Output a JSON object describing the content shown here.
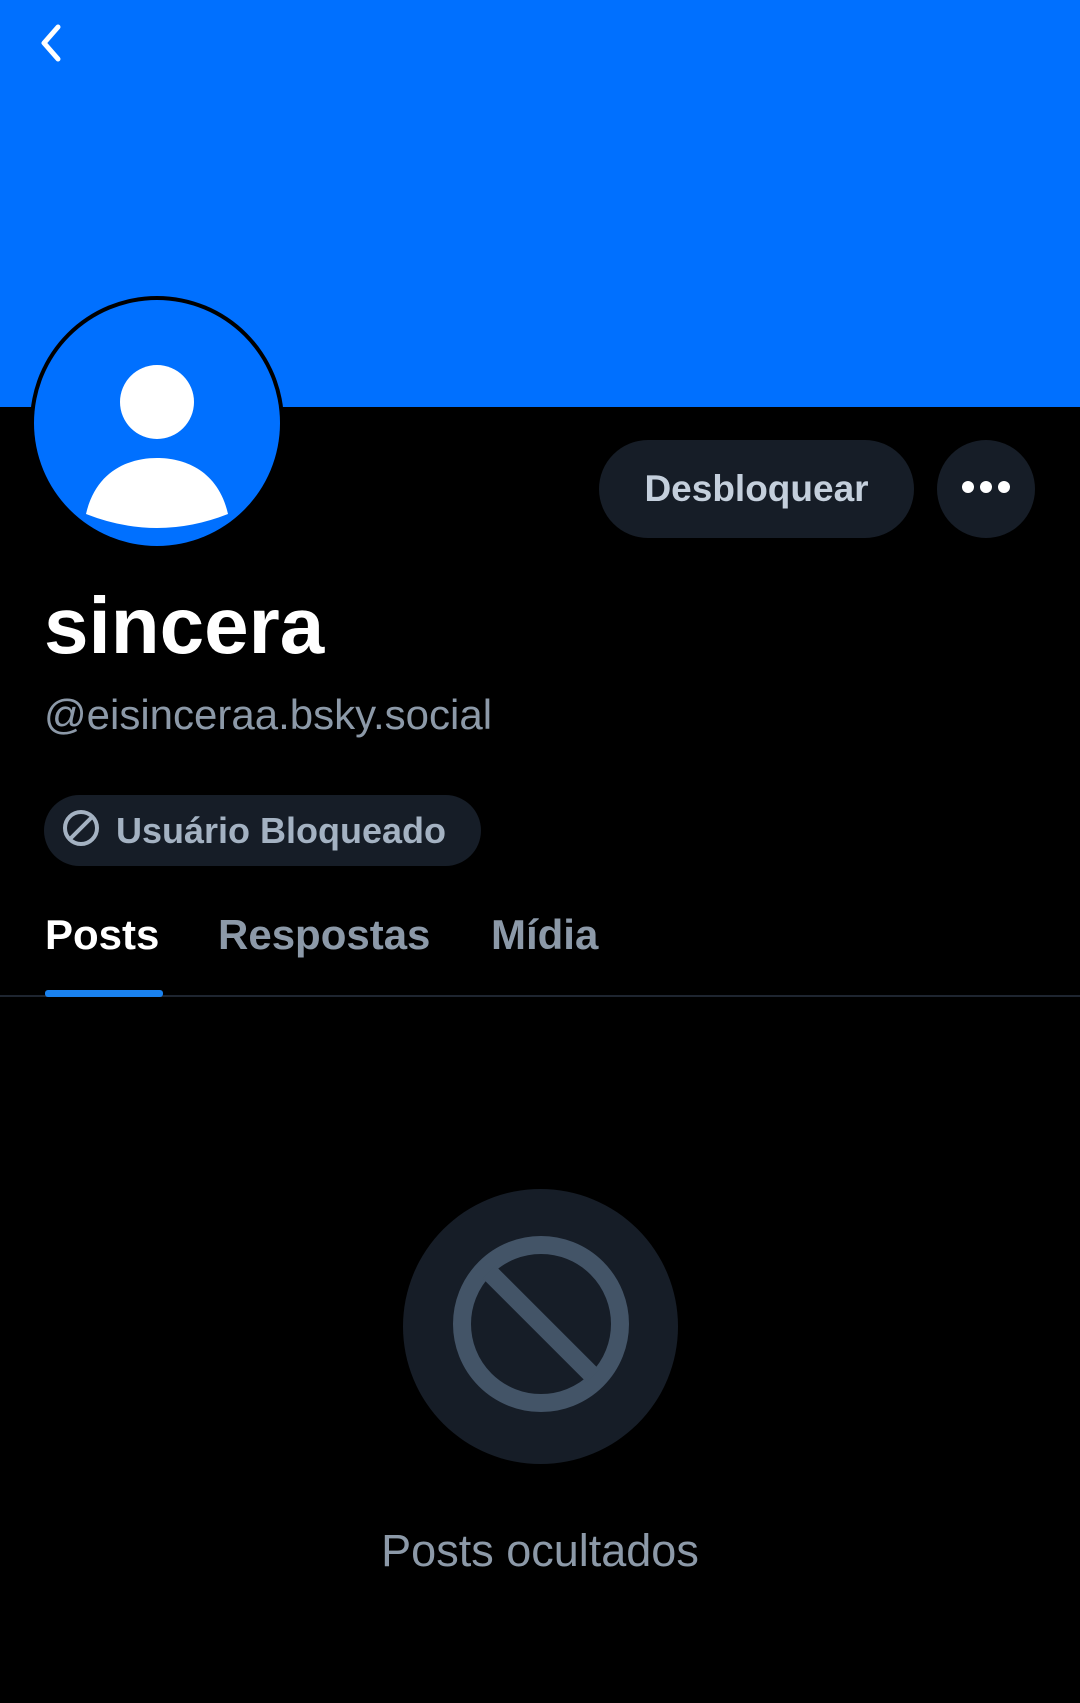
{
  "colors": {
    "banner": "#0070ff",
    "background": "#000000",
    "surface": "#161d27",
    "muted_text": "#8c99a8",
    "tab_indicator": "#1a82f0"
  },
  "header": {
    "back_icon": "chevron-left-icon"
  },
  "profile": {
    "avatar_icon": "default-user-avatar-icon",
    "display_name": "sincera",
    "handle": "@eisinceraa.bsky.social",
    "unblock_label": "Desbloquear",
    "more_icon": "ellipsis-icon",
    "blocked_badge": {
      "icon": "block-icon",
      "label": "Usuário Bloqueado"
    }
  },
  "tabs": [
    {
      "label": "Posts",
      "active": true
    },
    {
      "label": "Respostas",
      "active": false
    },
    {
      "label": "Mídia",
      "active": false
    }
  ],
  "empty_state": {
    "icon": "block-icon",
    "label": "Posts ocultados"
  }
}
